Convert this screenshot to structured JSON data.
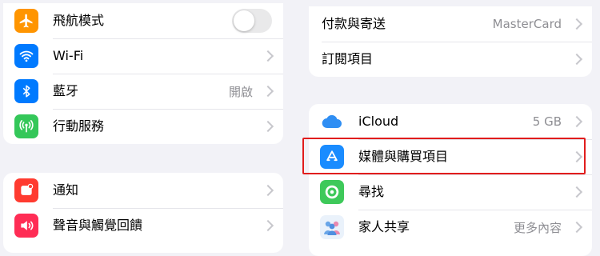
{
  "left": {
    "group1": [
      {
        "label": "飛航模式",
        "icon": "airplane-icon",
        "color": "#ff9500"
      },
      {
        "label": "Wi-Fi",
        "icon": "wifi-icon",
        "color": "#007aff"
      },
      {
        "label": "藍牙",
        "value": "開啟",
        "icon": "bluetooth-icon",
        "color": "#007aff"
      },
      {
        "label": "行動服務",
        "icon": "cellular-icon",
        "color": "#34c759"
      }
    ],
    "group2": [
      {
        "label": "通知",
        "icon": "notifications-icon",
        "color": "#ff3b30"
      },
      {
        "label": "聲音與觸覺回饋",
        "icon": "sounds-icon",
        "color": "#ff2d55"
      }
    ]
  },
  "right": {
    "group1": [
      {
        "label": "付款與寄送",
        "value": "MasterCard"
      },
      {
        "label": "訂閱項目"
      }
    ],
    "group2": [
      {
        "label": "iCloud",
        "value": "5 GB",
        "icon": "icloud-icon"
      },
      {
        "label": "媒體與購買項目",
        "icon": "app-store-icon"
      },
      {
        "label": "尋找",
        "icon": "find-my-icon"
      },
      {
        "label": "家人共享",
        "value": "更多內容",
        "icon": "family-sharing-icon"
      }
    ]
  },
  "highlight_color": "#e11d1d"
}
